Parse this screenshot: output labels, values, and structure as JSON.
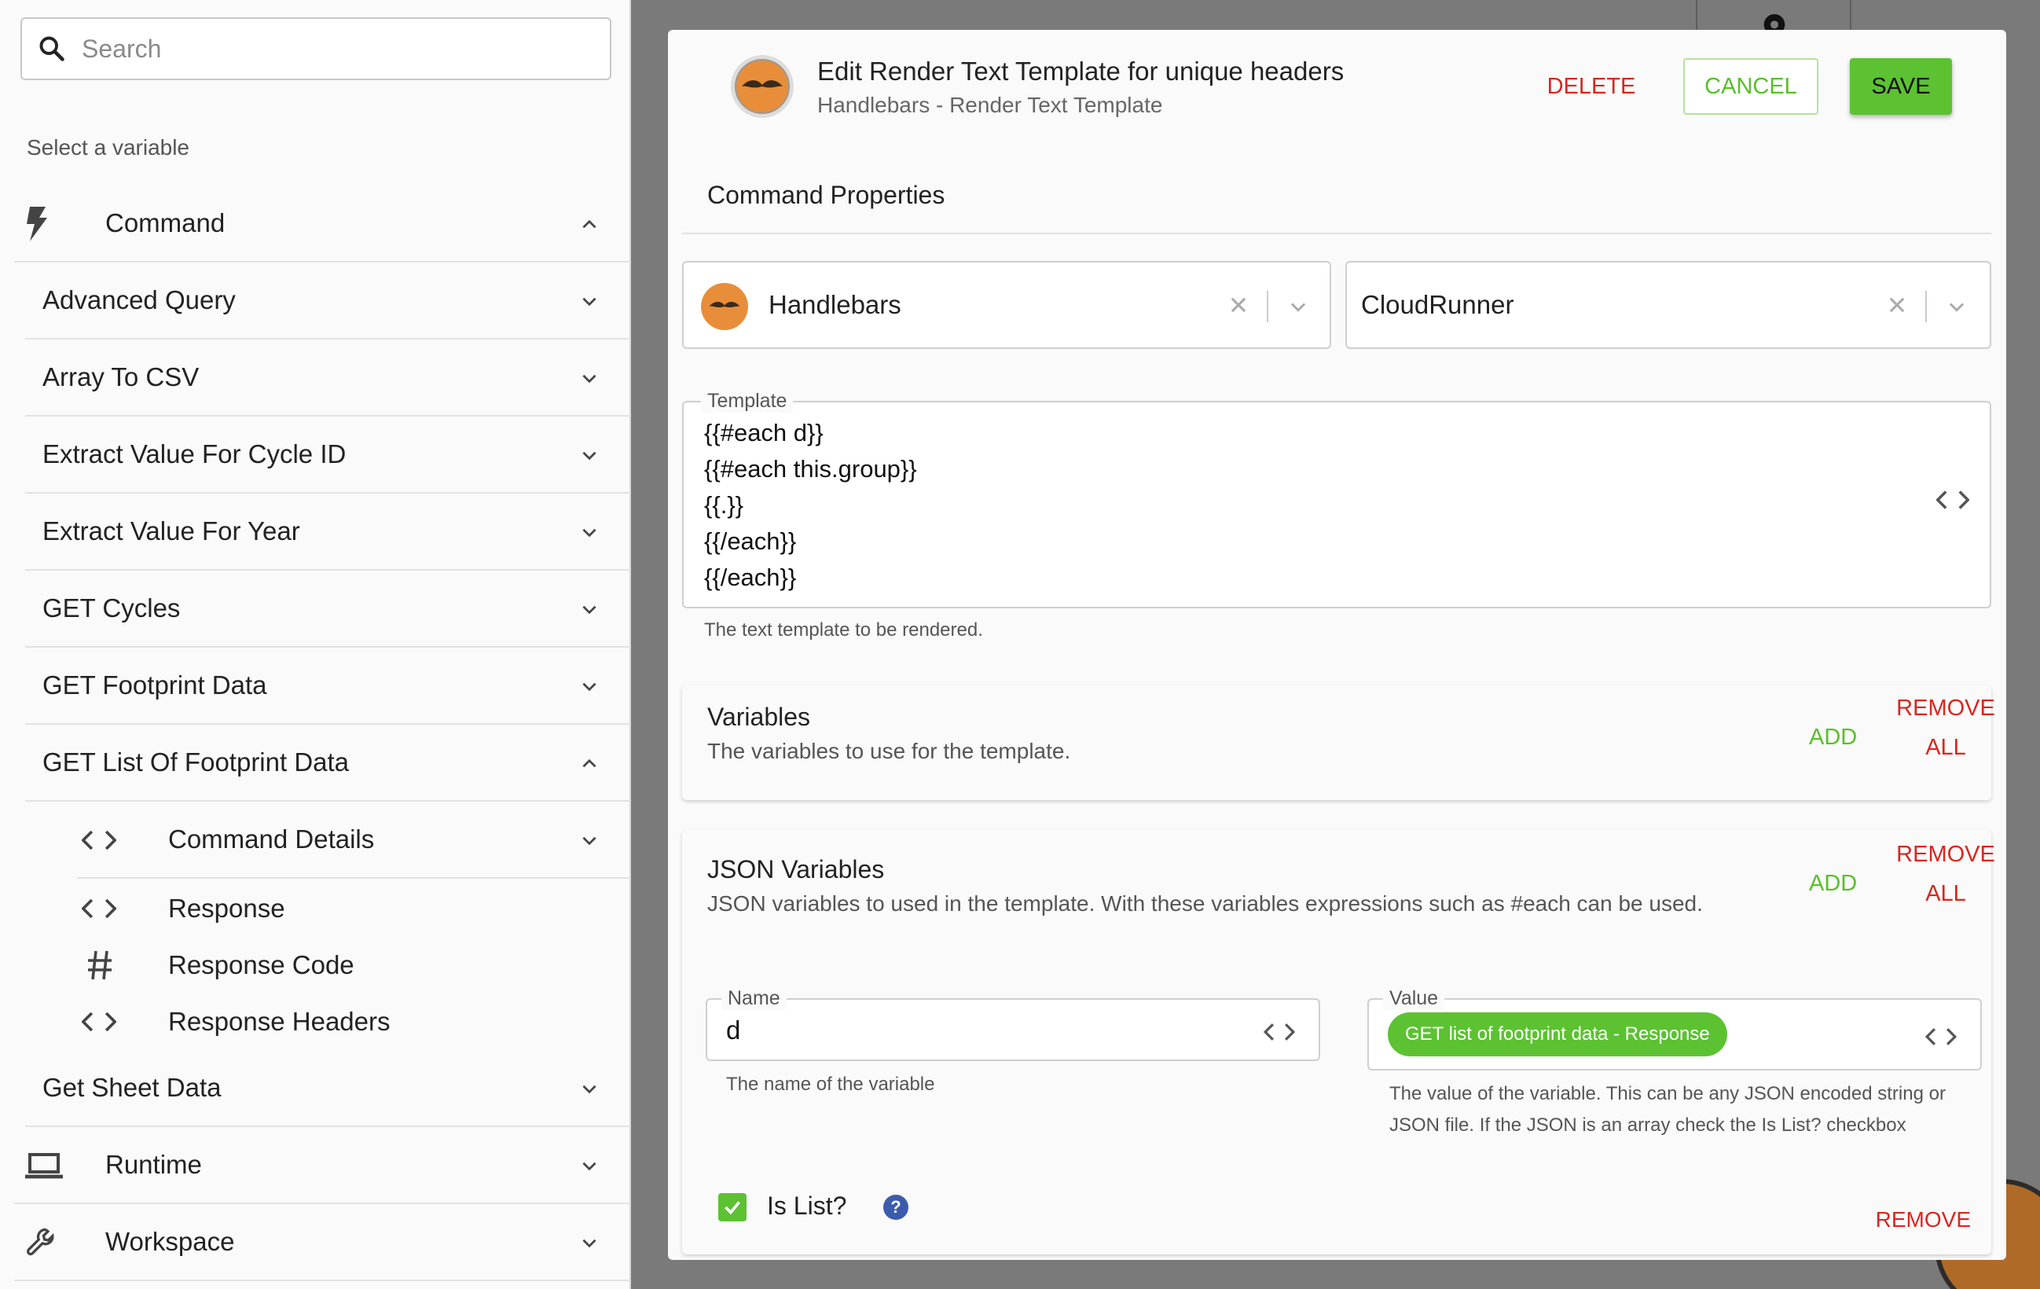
{
  "sidebar": {
    "search_placeholder": "Search",
    "select_label": "Select a variable",
    "sections": {
      "command": "Command",
      "runtime": "Runtime",
      "workspace": "Workspace"
    },
    "commands": [
      "Advanced Query",
      "Array To CSV",
      "Extract Value For Cycle ID",
      "Extract Value For Year",
      "GET Cycles",
      "GET Footprint Data",
      "GET List Of Footprint Data",
      "Get Sheet Data"
    ],
    "sub_items": {
      "command_details": "Command Details",
      "response": "Response",
      "response_code": "Response Code",
      "response_headers": "Response Headers"
    }
  },
  "modal": {
    "title": "Edit Render Text Template for unique headers",
    "subtitle": "Handlebars - Render Text Template",
    "delete_label": "DELETE",
    "cancel_label": "CANCEL",
    "save_label": "SAVE",
    "section_title": "Command Properties",
    "provider_select": "Handlebars",
    "runner_select": "CloudRunner",
    "template": {
      "legend": "Template",
      "lines": [
        "{{#each d}}",
        "{{#each this.group}}",
        "{{.}}",
        "{{/each}}",
        "{{/each}}"
      ],
      "help": "The text template to be rendered."
    },
    "variables_card": {
      "title": "Variables",
      "description": "The variables to use for the template.",
      "add_label": "ADD",
      "remove_all_line1": "REMOVE",
      "remove_all_line2": "ALL"
    },
    "json_card": {
      "title": "JSON Variables",
      "description": "JSON variables to used in the template. With these variables expressions such as #each can be used.",
      "add_label": "ADD",
      "remove_all_line1": "REMOVE",
      "remove_all_line2": "ALL",
      "name_legend": "Name",
      "name_value": "d",
      "name_help": "The name of the variable",
      "value_legend": "Value",
      "value_chip": "GET list of footprint data - Response",
      "value_help_line1": "The value of the variable. This can be any JSON encoded string or",
      "value_help_line2": "JSON file. If the JSON is an array check the Is List? checkbox",
      "is_list_label": "Is List?",
      "is_list_checked": true,
      "remove_label": "REMOVE"
    }
  },
  "colors": {
    "accent_green": "#5cc232",
    "danger_red": "#d8271f",
    "avatar_orange": "#e88e3a"
  }
}
